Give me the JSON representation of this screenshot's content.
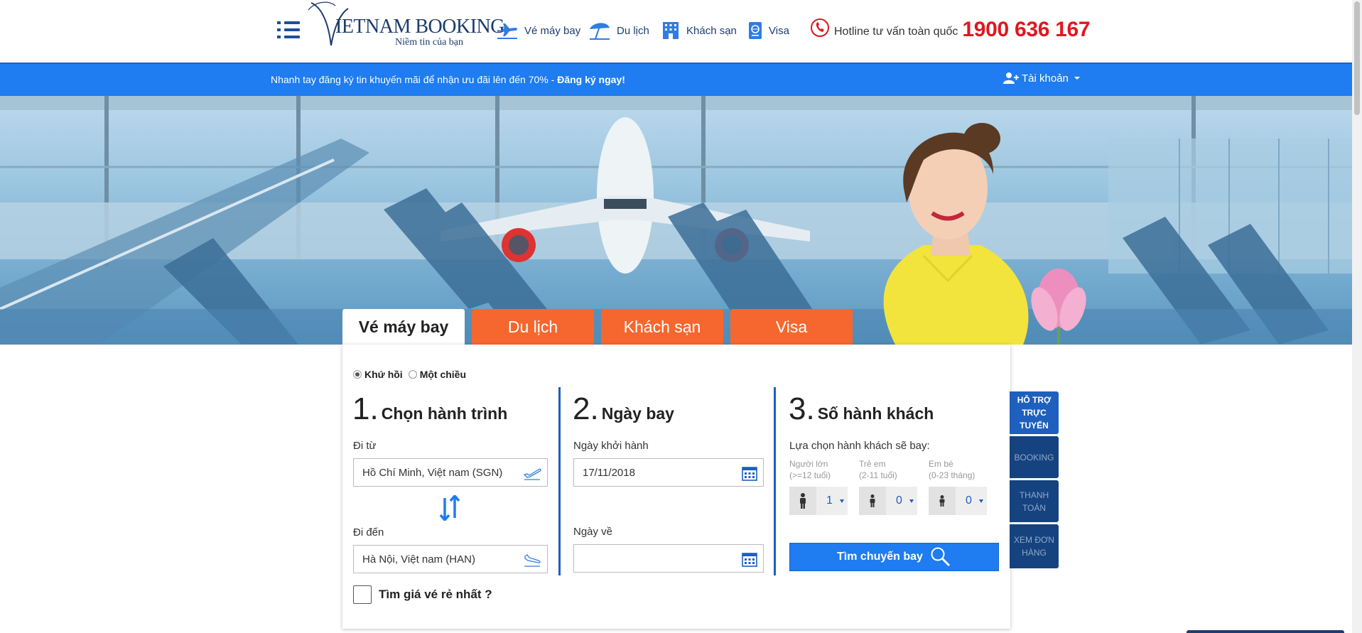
{
  "header": {
    "logo": {
      "brand": "IETNAM BOOKING",
      "tagline": "Niềm tin của bạn"
    },
    "nav": [
      {
        "label": "Vé máy bay",
        "icon": "airplane-icon"
      },
      {
        "label": "Du lịch",
        "icon": "beach-umbrella-icon"
      },
      {
        "label": "Khách sạn",
        "icon": "hotel-icon"
      },
      {
        "label": "Visa",
        "icon": "passport-icon"
      }
    ],
    "hotline": {
      "label": "Hotline tư vấn toàn quốc",
      "number": "1900 636 167"
    }
  },
  "promo_bar": {
    "text": "Nhanh tay đăng ký tin khuyến mãi để nhận ưu đãi lên đến 70% - ",
    "link": "Đăng ký ngay!",
    "account": "Tài khoản"
  },
  "tabs": [
    {
      "label": "Vé máy bay",
      "active": true
    },
    {
      "label": "Du lịch",
      "active": false
    },
    {
      "label": "Khách sạn",
      "active": false
    },
    {
      "label": "Visa",
      "active": false
    }
  ],
  "search": {
    "trip_types": [
      {
        "label": "Khứ hồi",
        "selected": true
      },
      {
        "label": "Một chiều",
        "selected": false
      }
    ],
    "step1": {
      "num": "1.",
      "title": "Chọn hành trình",
      "from_label": "Đi từ",
      "from_value": "Hồ Chí Minh, Việt nam (SGN)",
      "to_label": "Đi đến",
      "to_value": "Hà Nội, Việt nam (HAN)"
    },
    "step2": {
      "num": "2.",
      "title": "Ngày bay",
      "depart_label": "Ngày khởi hành",
      "depart_value": "17/11/2018",
      "return_label": "Ngày về",
      "return_value": ""
    },
    "step3": {
      "num": "3.",
      "title": "Số hành khách",
      "subtitle": "Lựa chọn hành khách sẽ bay:",
      "passengers": [
        {
          "label": "Người lớn",
          "age": "(>=12 tuổi)",
          "value": "1"
        },
        {
          "label": "Trẻ em",
          "age": "(2-11 tuổi)",
          "value": "0"
        },
        {
          "label": "Em bé",
          "age": "(0-23 tháng)",
          "value": "0"
        }
      ],
      "search_button": "Tìm chuyến bay"
    },
    "cheapest": "Tìm giá vé rẻ nhất ?"
  },
  "side_tabs": [
    {
      "label": "HỖ TRỢ TRỰC TUYẾN",
      "active": true
    },
    {
      "label": "BOOKING",
      "active": false
    },
    {
      "label": "THANH TOÁN",
      "active": false
    },
    {
      "label": "XEM ĐƠN HÀNG",
      "active": false
    }
  ],
  "colors": {
    "primary_blue": "#1f7cf1",
    "navy": "#1e3d6e",
    "orange_tab": "#f6672f",
    "hotline_red": "#e0171f"
  }
}
